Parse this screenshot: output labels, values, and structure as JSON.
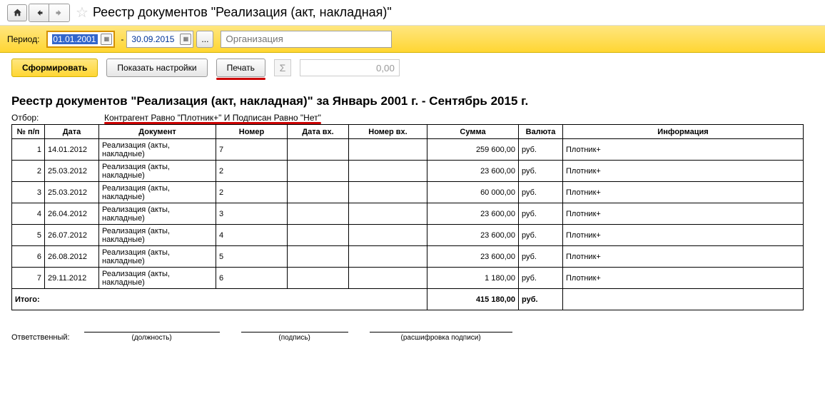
{
  "header": {
    "title": "Реестр документов \"Реализация (акт, накладная)\""
  },
  "period": {
    "label": "Период:",
    "from": "01.01.2001",
    "to": "30.09.2015",
    "org_placeholder": "Организация"
  },
  "actions": {
    "generate": "Сформировать",
    "settings": "Показать настройки",
    "print": "Печать",
    "sum_display": "0,00"
  },
  "report": {
    "title": "Реестр документов \"Реализация (акт, накладная)\"  за Январь 2001 г. - Сентябрь 2015 г.",
    "filter_label": "Отбор:",
    "filter_value": "Контрагент Равно \"Плотник+\" И Подписан Равно \"Нет\"",
    "columns": {
      "n": "№ п/п",
      "date": "Дата",
      "doc": "Документ",
      "num": "Номер",
      "date_in": "Дата вх.",
      "num_in": "Номер вх.",
      "sum": "Сумма",
      "cur": "Валюта",
      "info": "Информация"
    },
    "rows": [
      {
        "n": "1",
        "date": "14.01.2012",
        "doc": "Реализация (акты, накладные)",
        "num": "7",
        "date_in": "",
        "num_in": "",
        "sum": "259 600,00",
        "cur": "руб.",
        "info": "Плотник+"
      },
      {
        "n": "2",
        "date": "25.03.2012",
        "doc": "Реализация (акты, накладные)",
        "num": "2",
        "date_in": "",
        "num_in": "",
        "sum": "23 600,00",
        "cur": "руб.",
        "info": "Плотник+"
      },
      {
        "n": "3",
        "date": "25.03.2012",
        "doc": "Реализация (акты, накладные)",
        "num": "2",
        "date_in": "",
        "num_in": "",
        "sum": "60 000,00",
        "cur": "руб.",
        "info": "Плотник+"
      },
      {
        "n": "4",
        "date": "26.04.2012",
        "doc": "Реализация (акты, накладные)",
        "num": "3",
        "date_in": "",
        "num_in": "",
        "sum": "23 600,00",
        "cur": "руб.",
        "info": "Плотник+"
      },
      {
        "n": "5",
        "date": "26.07.2012",
        "doc": "Реализация (акты, накладные)",
        "num": "4",
        "date_in": "",
        "num_in": "",
        "sum": "23 600,00",
        "cur": "руб.",
        "info": "Плотник+"
      },
      {
        "n": "6",
        "date": "26.08.2012",
        "doc": "Реализация (акты, накладные)",
        "num": "5",
        "date_in": "",
        "num_in": "",
        "sum": "23 600,00",
        "cur": "руб.",
        "info": "Плотник+"
      },
      {
        "n": "7",
        "date": "29.11.2012",
        "doc": "Реализация (акты, накладные)",
        "num": "6",
        "date_in": "",
        "num_in": "",
        "sum": "1 180,00",
        "cur": "руб.",
        "info": "Плотник+"
      }
    ],
    "total_label": "Итого:",
    "total_sum": "415 180,00",
    "total_cur": "руб."
  },
  "signatures": {
    "responsible": "Ответственный:",
    "position": "(должность)",
    "sign": "(подпись)",
    "decipher": "(расшифровка подписи)"
  }
}
